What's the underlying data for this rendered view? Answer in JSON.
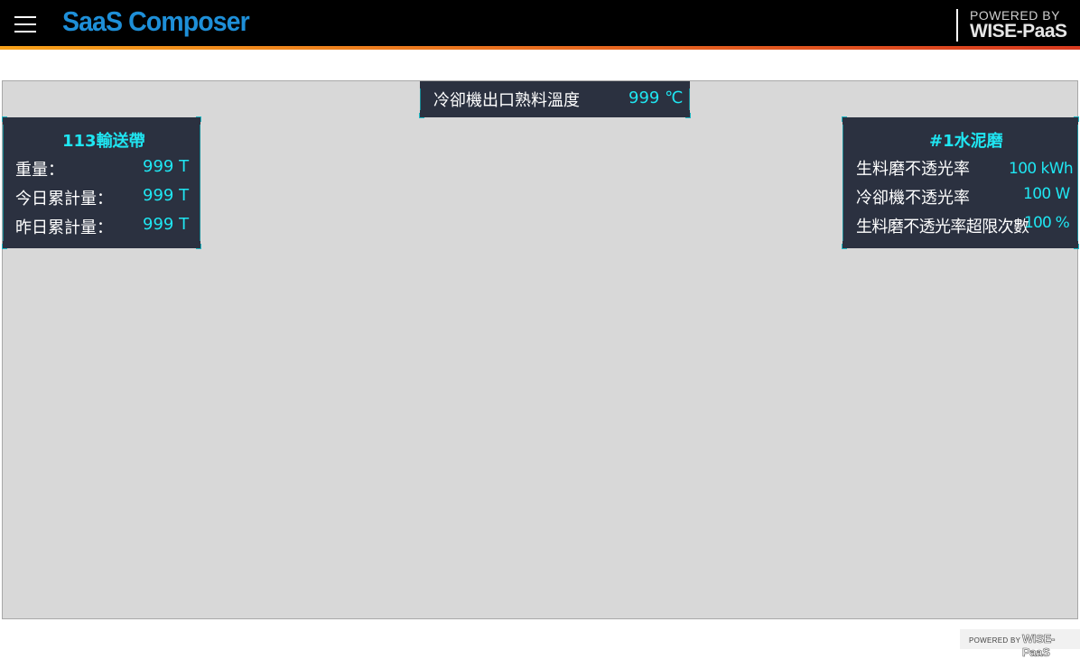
{
  "header": {
    "app_title": "SaaS Composer",
    "powered_by_label": "POWERED BY",
    "powered_by_brand": "WISE-PaaS",
    "menu_icon": "hamburger-menu-icon"
  },
  "cooler_outlet": {
    "label": "冷卻機出口熟料溫度",
    "value": "999 ℃"
  },
  "conveyor_113": {
    "title": "113輸送帶",
    "rows": [
      {
        "label": "重量：",
        "value": "999 T"
      },
      {
        "label": "今日累計量：",
        "value": "999 T"
      },
      {
        "label": "昨日累計量：",
        "value": "999 T"
      }
    ]
  },
  "cement_mill_1": {
    "title": "#1水泥磨",
    "rows": [
      {
        "label": "生料磨不透光率",
        "value": "100 kWh"
      },
      {
        "label": "冷卻機不透光率",
        "value": "100 W"
      },
      {
        "label": "生料磨不透光率超限次數",
        "value": "100 %"
      }
    ]
  },
  "footer": {
    "powered_by_label": "POWERED BY",
    "powered_by_brand": "WISE-PaaS"
  },
  "colors": {
    "brand_blue": "#1e8fd8",
    "panel_bg": "#2b3140",
    "value_cyan": "#1fe6f2",
    "canvas_bg": "#d8d8d8"
  }
}
